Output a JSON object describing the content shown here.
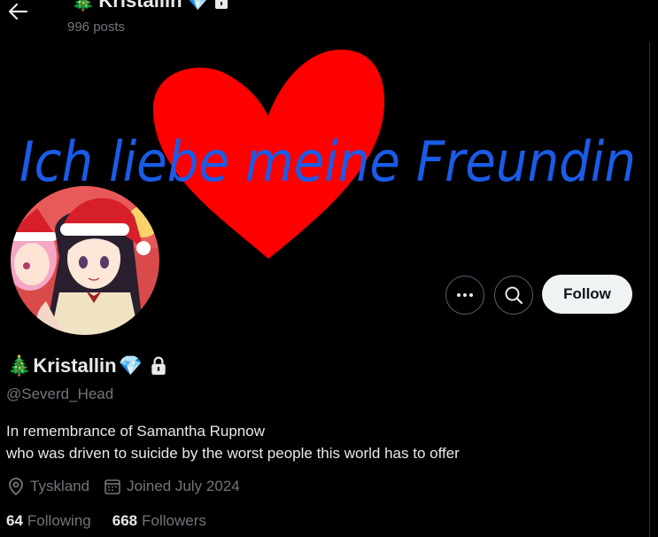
{
  "header": {
    "name_prefix_emoji": "🎄",
    "name": "Kristallin",
    "name_suffix_emoji": "💎",
    "posts": "996 posts"
  },
  "banner": {
    "handwritten_text": "Ich liebe meine Freundin",
    "text_color": "#1a5ce8",
    "heart_color": "#ff0000"
  },
  "actions": {
    "more_icon": "more-horizontal-icon",
    "search_icon": "search-icon",
    "follow_label": "Follow"
  },
  "profile": {
    "name_prefix_emoji": "🎄",
    "name": "Kristallin",
    "name_suffix_emoji": "💎",
    "handle": "@Severd_Head",
    "bio_line1": "In remembrance of Samantha Rupnow",
    "bio_line2": "who was driven to suicide by the worst people this world has to offer",
    "location": "Tyskland",
    "joined": "Joined July 2024",
    "following_count": "64",
    "following_label": "Following",
    "followers_count": "668",
    "followers_label": "Followers"
  },
  "colors": {
    "background": "#000000",
    "text_primary": "#e7e9ea",
    "text_secondary": "#71767b",
    "button_border": "#536471",
    "follow_bg": "#eff3f4"
  }
}
